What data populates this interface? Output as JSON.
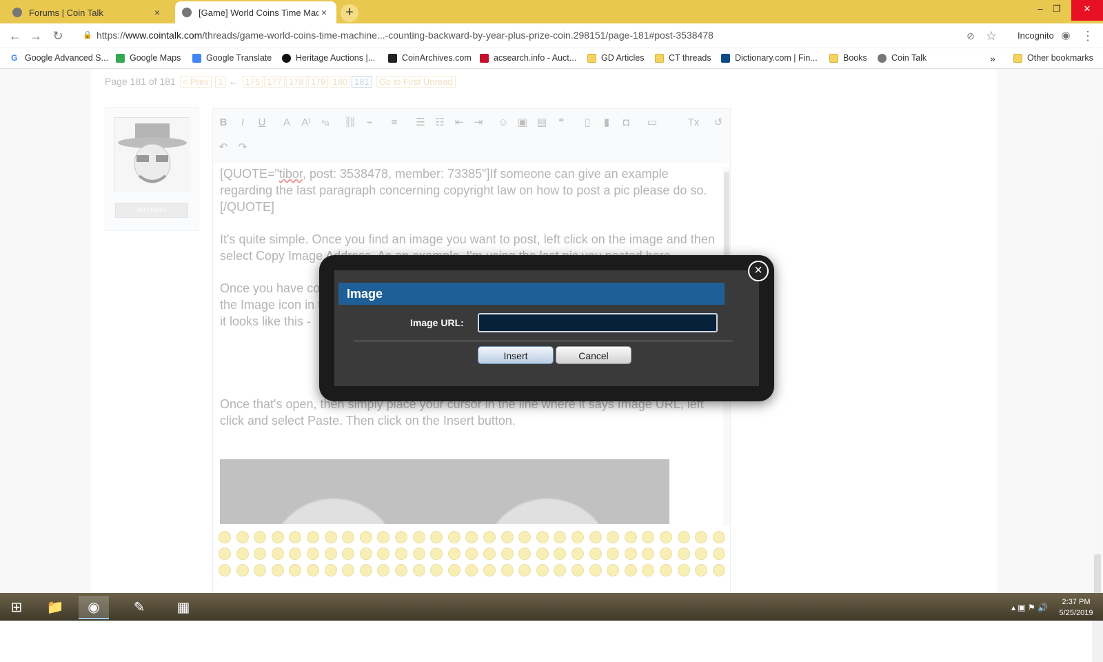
{
  "tabs": [
    {
      "title": "Forums | Coin Talk",
      "close": "×"
    },
    {
      "title": "[Game] World Coins Time Machi",
      "close": "×"
    }
  ],
  "new_tab": "+",
  "window_controls": {
    "minimize": "–",
    "maximize": "❐",
    "close": "✕"
  },
  "address_bar": {
    "scheme": "https://",
    "host": "www.cointalk.com",
    "path": "/threads/game-world-coins-time-machine...-counting-backward-by-year-plus-prize-coin.298151/page-181#post-3538478"
  },
  "incognito_label": "Incognito",
  "bookmarks": [
    {
      "label": "Google Advanced S...",
      "icon": "google-icon"
    },
    {
      "label": "Google Maps",
      "icon": "maps-icon"
    },
    {
      "label": "Google Translate",
      "icon": "translate-icon"
    },
    {
      "label": "Heritage Auctions |...",
      "icon": "ha-icon"
    },
    {
      "label": "CoinArchives.com",
      "icon": "ca-icon"
    },
    {
      "label": "acsearch.info - Auct...",
      "icon": "acsearch-icon"
    },
    {
      "label": "GD Articles",
      "icon": "folder-icon"
    },
    {
      "label": "CT threads",
      "icon": "folder-icon"
    },
    {
      "label": "Dictionary.com | Fin...",
      "icon": "dictionary-icon"
    },
    {
      "label": "Books",
      "icon": "folder-icon"
    },
    {
      "label": "Coin Talk",
      "icon": "cointalk-icon"
    }
  ],
  "bookmarks_more": "»",
  "other_bookmarks": "Other bookmarks",
  "page_nav": {
    "text": "Page 181 of 181",
    "prev": "< Prev",
    "first": "1",
    "arrow": "←",
    "pages": [
      "176",
      "177",
      "178",
      "179",
      "180",
      "181"
    ],
    "go_first_unread": "Go to First Unread"
  },
  "avatar_no_photo": "NO PHOTO",
  "editor": {
    "quote_prefix": "[QUOTE=\"",
    "quote_name": "tibor",
    "quote_rest": ", post: 3538478, member: 73385\"]If someone can give an example regarding the last paragraph concerning copyright law on how to post a pic please do so.[/QUOTE]",
    "para2": "It's quite simple. Once you find an image you want to post, left click on the image and then select Copy Image Address. As an example, I'm using the last pic you posted here.",
    "para3": "Once you have copied the image address, there here in your posting box, simply click on the Image icon in the toolbar, just to the right of the smiley face icon. Once you click on it, it looks like this -",
    "para4": "Once that's open, then simply place your cursor in the line where it says Image URL, left click and select Paste. Then click on the Insert button."
  },
  "dialog": {
    "title": "Image",
    "url_label": "Image URL:",
    "url_value": "",
    "insert": "Insert",
    "cancel": "Cancel",
    "close": "×"
  },
  "clock": {
    "time": "2:37 PM",
    "date": "5/25/2019"
  }
}
